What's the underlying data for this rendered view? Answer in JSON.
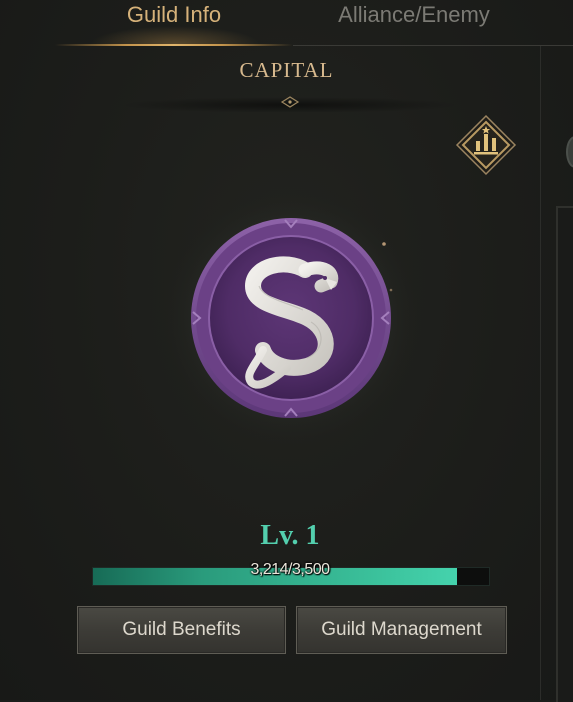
{
  "tabs": [
    {
      "label": "Guild Info",
      "active": true
    },
    {
      "label": "Alliance/Enemy",
      "active": false
    }
  ],
  "capital": {
    "title": "CAPITAL"
  },
  "ranking": {
    "icon": "ranking-bars-icon"
  },
  "emblem": {
    "icon": "serpent-emblem-icon",
    "color": "#6b3d86"
  },
  "level": {
    "label": "Lv. 1",
    "progress_text": "3,214/3,500",
    "current": 3214,
    "max": 3500
  },
  "buttons": {
    "benefits_label": "Guild Benefits",
    "management_label": "Guild Management"
  },
  "colors": {
    "accent_gold": "#d6b27a",
    "level_teal": "#53cfae",
    "progress_fill": "#3cc39d"
  }
}
